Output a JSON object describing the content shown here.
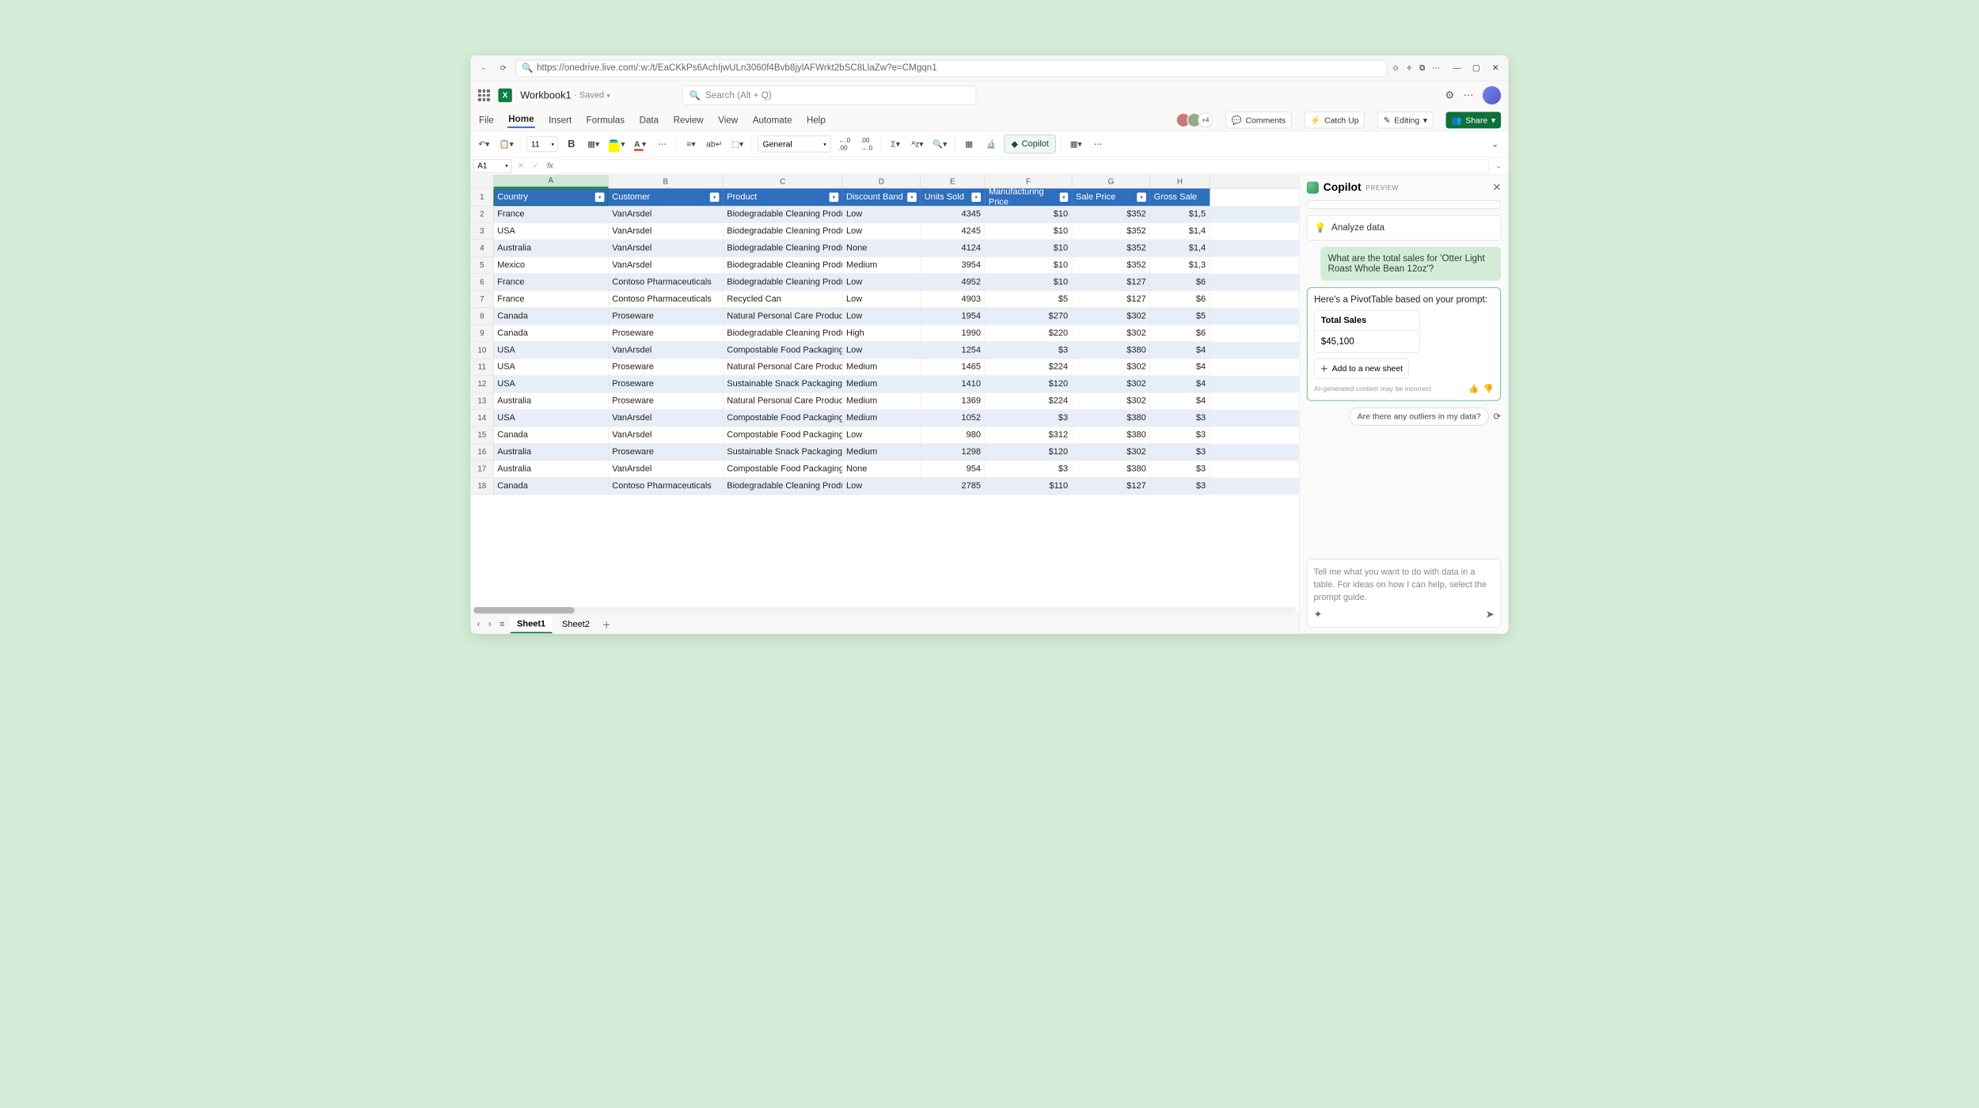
{
  "browser": {
    "url": "https://onedrive.live.com/:w:/t/EaCKkPs6AchIjwULn3060f4Bvb8jylAFWrkt2bSC8LlaZw?e=CMgqn1"
  },
  "app": {
    "doc_name": "Workbook1",
    "saved_label": "· Saved",
    "search_placeholder": "Search (Alt + Q)"
  },
  "tabs": [
    "File",
    "Home",
    "Insert",
    "Formulas",
    "Data",
    "Review",
    "View",
    "Automate",
    "Help"
  ],
  "active_tab": "Home",
  "presence_extra": "+4",
  "header_buttons": {
    "comments": "Comments",
    "catchup": "Catch Up",
    "editing": "Editing",
    "share": "Share"
  },
  "ribbon": {
    "font_size": "11",
    "number_format": "General",
    "copilot": "Copilot"
  },
  "formula_bar": {
    "cell": "A1",
    "formula": ""
  },
  "columns_letters": [
    "A",
    "B",
    "C",
    "D",
    "E",
    "F",
    "G",
    "H"
  ],
  "table_headers": [
    "Country",
    "Customer",
    "Product",
    "Discount Band",
    "Units Sold",
    "Manufacturing Price",
    "Sale Price",
    "Gross Sale"
  ],
  "rows": [
    {
      "n": 2,
      "c": [
        "France",
        "VanArsdel",
        "Biodegradable Cleaning Products",
        "Low",
        "4345",
        "$10",
        "$352",
        "$1,5"
      ]
    },
    {
      "n": 3,
      "c": [
        "USA",
        "VanArsdel",
        "Biodegradable Cleaning Products",
        "Low",
        "4245",
        "$10",
        "$352",
        "$1,4"
      ]
    },
    {
      "n": 4,
      "c": [
        "Australia",
        "VanArsdel",
        "Biodegradable Cleaning Products",
        "None",
        "4124",
        "$10",
        "$352",
        "$1,4"
      ]
    },
    {
      "n": 5,
      "c": [
        "Mexico",
        "VanArsdel",
        "Biodegradable Cleaning Products",
        "Medium",
        "3954",
        "$10",
        "$352",
        "$1,3"
      ]
    },
    {
      "n": 6,
      "c": [
        "France",
        "Contoso Pharmaceuticals",
        "Biodegradable Cleaning Products",
        "Low",
        "4952",
        "$10",
        "$127",
        "$6"
      ]
    },
    {
      "n": 7,
      "c": [
        "France",
        "Contoso Pharmaceuticals",
        "Recycled Can",
        "Low",
        "4903",
        "$5",
        "$127",
        "$6"
      ]
    },
    {
      "n": 8,
      "c": [
        "Canada",
        "Proseware",
        "Natural Personal Care Products",
        "Low",
        "1954",
        "$270",
        "$302",
        "$5"
      ]
    },
    {
      "n": 9,
      "c": [
        "Canada",
        "Proseware",
        "Biodegradable Cleaning Products",
        "High",
        "1990",
        "$220",
        "$302",
        "$6"
      ]
    },
    {
      "n": 10,
      "c": [
        "USA",
        "VanArsdel",
        "Compostable Food Packaging",
        "Low",
        "1254",
        "$3",
        "$380",
        "$4"
      ]
    },
    {
      "n": 11,
      "c": [
        "USA",
        "Proseware",
        "Natural Personal Care Products",
        "Medium",
        "1465",
        "$224",
        "$302",
        "$4"
      ]
    },
    {
      "n": 12,
      "c": [
        "USA",
        "Proseware",
        "Sustainable Snack Packaging",
        "Medium",
        "1410",
        "$120",
        "$302",
        "$4"
      ]
    },
    {
      "n": 13,
      "c": [
        "Australia",
        "Proseware",
        "Natural Personal Care Products",
        "Medium",
        "1369",
        "$224",
        "$302",
        "$4"
      ]
    },
    {
      "n": 14,
      "c": [
        "USA",
        "VanArsdel",
        "Compostable Food Packaging",
        "Medium",
        "1052",
        "$3",
        "$380",
        "$3"
      ]
    },
    {
      "n": 15,
      "c": [
        "Canada",
        "VanArsdel",
        "Compostable Food Packaging",
        "Low",
        "980",
        "$312",
        "$380",
        "$3"
      ]
    },
    {
      "n": 16,
      "c": [
        "Australia",
        "Proseware",
        "Sustainable Snack Packaging",
        "Medium",
        "1298",
        "$120",
        "$302",
        "$3"
      ]
    },
    {
      "n": 17,
      "c": [
        "Australia",
        "VanArsdel",
        "Compostable Food Packaging",
        "None",
        "954",
        "$3",
        "$380",
        "$3"
      ]
    },
    {
      "n": 18,
      "c": [
        "Canada",
        "Contoso Pharmaceuticals",
        "Biodegradable Cleaning Products",
        "Low",
        "2785",
        "$110",
        "$127",
        "$3"
      ]
    }
  ],
  "sheets": [
    "Sheet1",
    "Sheet2"
  ],
  "active_sheet": "Sheet1",
  "copilot": {
    "title": "Copilot",
    "preview": "PREVIEW",
    "suggestion": "Analyze data",
    "user_message": "What are the total sales for 'Otter Light Roast Whole Bean 12oz'?",
    "assist_intro": "Here's a PivotTable based on your prompt:",
    "pivot_header": "Total Sales",
    "pivot_value": "$45,100",
    "add_sheet": "Add to a new sheet",
    "disclaimer": "AI-generated content may be incorrect",
    "outlier_chip": "Are there any outliers in my data?",
    "input_placeholder": "Tell me what you want to do with data in a table. For ideas on how I can help, select the prompt guide."
  }
}
